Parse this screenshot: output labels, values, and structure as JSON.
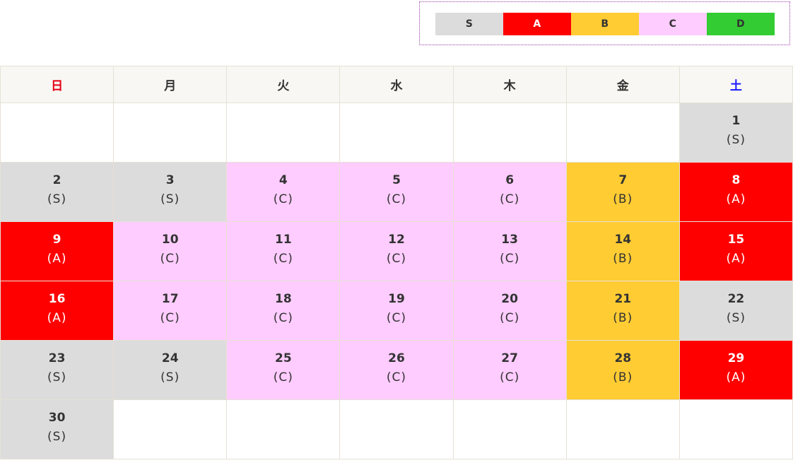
{
  "colors": {
    "S": "#dcdcdc",
    "A": "#ff0000",
    "B": "#ffcc33",
    "C": "#ffccff",
    "D": "#33cc33",
    "text_dark": "#333333",
    "text_light": "#ffffff",
    "sunday": "#e60012",
    "saturday": "#1a1aff"
  },
  "legend": [
    {
      "label": "S",
      "rank": "S"
    },
    {
      "label": "A",
      "rank": "A"
    },
    {
      "label": "B",
      "rank": "B"
    },
    {
      "label": "C",
      "rank": "C"
    },
    {
      "label": "D",
      "rank": "D"
    }
  ],
  "weekdays": [
    "日",
    "月",
    "火",
    "水",
    "木",
    "金",
    "土"
  ],
  "first_weekday_index": 6,
  "days": [
    {
      "day": "1",
      "rank": "S",
      "label": "(S)"
    },
    {
      "day": "2",
      "rank": "S",
      "label": "(S)"
    },
    {
      "day": "3",
      "rank": "S",
      "label": "(S)"
    },
    {
      "day": "4",
      "rank": "C",
      "label": "(C)"
    },
    {
      "day": "5",
      "rank": "C",
      "label": "(C)"
    },
    {
      "day": "6",
      "rank": "C",
      "label": "(C)"
    },
    {
      "day": "7",
      "rank": "B",
      "label": "(B)"
    },
    {
      "day": "8",
      "rank": "A",
      "label": "(A)"
    },
    {
      "day": "9",
      "rank": "A",
      "label": "(A)"
    },
    {
      "day": "10",
      "rank": "C",
      "label": "(C)"
    },
    {
      "day": "11",
      "rank": "C",
      "label": "(C)"
    },
    {
      "day": "12",
      "rank": "C",
      "label": "(C)"
    },
    {
      "day": "13",
      "rank": "C",
      "label": "(C)"
    },
    {
      "day": "14",
      "rank": "B",
      "label": "(B)"
    },
    {
      "day": "15",
      "rank": "A",
      "label": "(A)"
    },
    {
      "day": "16",
      "rank": "A",
      "label": "(A)"
    },
    {
      "day": "17",
      "rank": "C",
      "label": "(C)"
    },
    {
      "day": "18",
      "rank": "C",
      "label": "(C)"
    },
    {
      "day": "19",
      "rank": "C",
      "label": "(C)"
    },
    {
      "day": "20",
      "rank": "C",
      "label": "(C)"
    },
    {
      "day": "21",
      "rank": "B",
      "label": "(B)"
    },
    {
      "day": "22",
      "rank": "S",
      "label": "(S)"
    },
    {
      "day": "23",
      "rank": "S",
      "label": "(S)"
    },
    {
      "day": "24",
      "rank": "S",
      "label": "(S)"
    },
    {
      "day": "25",
      "rank": "C",
      "label": "(C)"
    },
    {
      "day": "26",
      "rank": "C",
      "label": "(C)"
    },
    {
      "day": "27",
      "rank": "C",
      "label": "(C)"
    },
    {
      "day": "28",
      "rank": "B",
      "label": "(B)"
    },
    {
      "day": "29",
      "rank": "A",
      "label": "(A)"
    },
    {
      "day": "30",
      "rank": "S",
      "label": "(S)"
    }
  ]
}
